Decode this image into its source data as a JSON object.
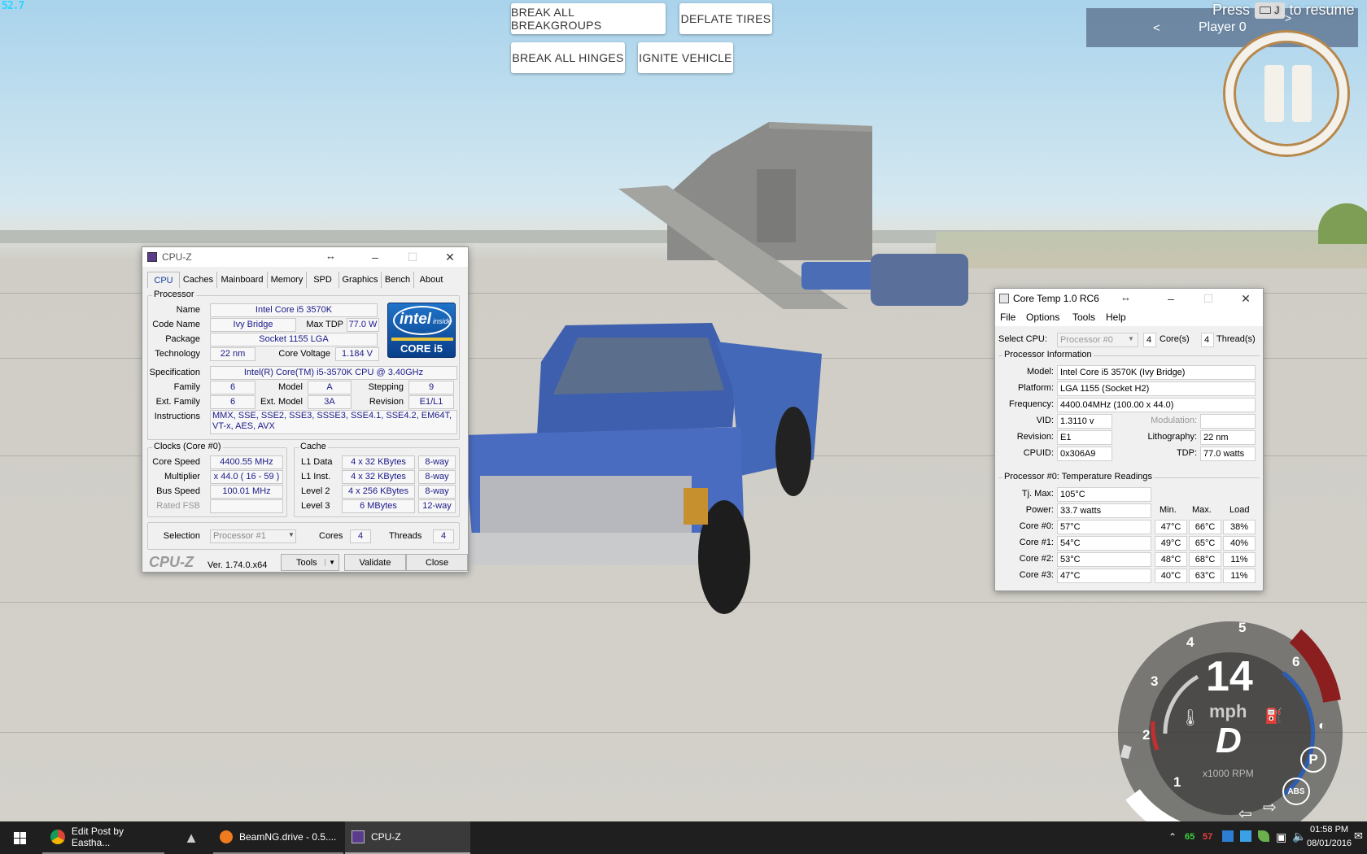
{
  "hud": {
    "fps": "52.7",
    "buttons": [
      "BREAK ALL BREAKGROUPS",
      "DEFLATE TIRES",
      "BREAK ALL HINGES",
      "IGNITE VEHICLE"
    ],
    "resume_press": "Press",
    "resume_key": "J",
    "resume_suffix": "to resume",
    "player_prev": "<",
    "player_label": "Player 0",
    "player_next": ">"
  },
  "gauge": {
    "speed": "14",
    "unit": "mph",
    "gear": "D",
    "rpm_label": "x1000 RPM",
    "ticks": [
      "1",
      "2",
      "3",
      "4",
      "5",
      "6"
    ],
    "park": "P",
    "abs": "ABS"
  },
  "cpuz": {
    "title": "CPU-Z",
    "tabs": [
      "CPU",
      "Caches",
      "Mainboard",
      "Memory",
      "SPD",
      "Graphics",
      "Bench",
      "About"
    ],
    "processor_group": "Processor",
    "name_label": "Name",
    "name": "Intel Core i5 3570K",
    "codename_label": "Code Name",
    "codename": "Ivy Bridge",
    "maxtdp_label": "Max TDP",
    "maxtdp": "77.0 W",
    "package_label": "Package",
    "package": "Socket 1155 LGA",
    "technology_label": "Technology",
    "technology": "22 nm",
    "voltage_label": "Core Voltage",
    "voltage": "1.184 V",
    "spec_label": "Specification",
    "spec": "Intel(R) Core(TM) i5-3570K CPU @ 3.40GHz",
    "family_label": "Family",
    "family": "6",
    "model_label": "Model",
    "model": "A",
    "stepping_label": "Stepping",
    "stepping": "9",
    "extfamily_label": "Ext. Family",
    "extfamily": "6",
    "extmodel_label": "Ext. Model",
    "extmodel": "3A",
    "revision_label": "Revision",
    "revision": "E1/L1",
    "instructions_label": "Instructions",
    "instructions": "MMX, SSE, SSE2, SSE3, SSSE3, SSE4.1, SSE4.2, EM64T, VT-x, AES, AVX",
    "logo_brand": "intel",
    "logo_inside": "inside",
    "logo_model": "CORE i5",
    "clocks_group": "Clocks (Core #0)",
    "corespeed_label": "Core Speed",
    "corespeed": "4400.55 MHz",
    "multiplier_label": "Multiplier",
    "multiplier": "x 44.0 ( 16 - 59 )",
    "busspeed_label": "Bus Speed",
    "busspeed": "100.01 MHz",
    "ratedfsb_label": "Rated FSB",
    "ratedfsb": "",
    "cache_group": "Cache",
    "l1d_label": "L1 Data",
    "l1d": "4 x 32 KBytes",
    "l1d_way": "8-way",
    "l1i_label": "L1 Inst.",
    "l1i": "4 x 32 KBytes",
    "l1i_way": "8-way",
    "l2_label": "Level 2",
    "l2": "4 x 256 KBytes",
    "l2_way": "8-way",
    "l3_label": "Level 3",
    "l3": "6 MBytes",
    "l3_way": "12-way",
    "selection_label": "Selection",
    "selection": "Processor #1",
    "cores_label": "Cores",
    "cores": "4",
    "threads_label": "Threads",
    "threads": "4",
    "footer_brand": "CPU-Z",
    "version": "Ver. 1.74.0.x64",
    "tools_btn": "Tools",
    "validate_btn": "Validate",
    "close_btn": "Close"
  },
  "coretemp": {
    "title": "Core Temp 1.0 RC6",
    "menu": [
      "File",
      "Options",
      "Tools",
      "Help"
    ],
    "selectcpu_label": "Select CPU:",
    "selectcpu": "Processor #0",
    "cores_num": "4",
    "cores_label": "Core(s)",
    "threads_num": "4",
    "threads_label": "Thread(s)",
    "info_group": "Processor Information",
    "model_label": "Model:",
    "model": "Intel Core i5 3570K (Ivy Bridge)",
    "platform_label": "Platform:",
    "platform": "LGA 1155 (Socket H2)",
    "frequency_label": "Frequency:",
    "frequency": "4400.04MHz (100.00 x 44.0)",
    "vid_label": "VID:",
    "vid": "1.3110 v",
    "modulation_label": "Modulation:",
    "modulation": "",
    "revision_label": "Revision:",
    "revision": "E1",
    "lithography_label": "Lithography:",
    "lithography": "22 nm",
    "cpuid_label": "CPUID:",
    "cpuid": "0x306A9",
    "tdp_label": "TDP:",
    "tdp": "77.0 watts",
    "temp_group": "Processor #0: Temperature Readings",
    "tjmax_label": "Tj. Max:",
    "tjmax": "105°C",
    "power_label": "Power:",
    "power": "33.7 watts",
    "col_min": "Min.",
    "col_max": "Max.",
    "col_load": "Load",
    "cores": [
      {
        "label": "Core #0:",
        "temp": "57°C",
        "min": "47°C",
        "max": "66°C",
        "load": "38%"
      },
      {
        "label": "Core #1:",
        "temp": "54°C",
        "min": "49°C",
        "max": "65°C",
        "load": "40%"
      },
      {
        "label": "Core #2:",
        "temp": "53°C",
        "min": "48°C",
        "max": "68°C",
        "load": "11%"
      },
      {
        "label": "Core #3:",
        "temp": "47°C",
        "min": "40°C",
        "max": "63°C",
        "load": "11%"
      }
    ]
  },
  "taskbar": {
    "items": [
      "Edit Post by Eastha...",
      "BeamNG.drive - 0.5....",
      "CPU-Z"
    ],
    "tray_temp1": "65",
    "tray_temp2": "57",
    "time": "01:58 PM",
    "date": "08/01/2016"
  }
}
